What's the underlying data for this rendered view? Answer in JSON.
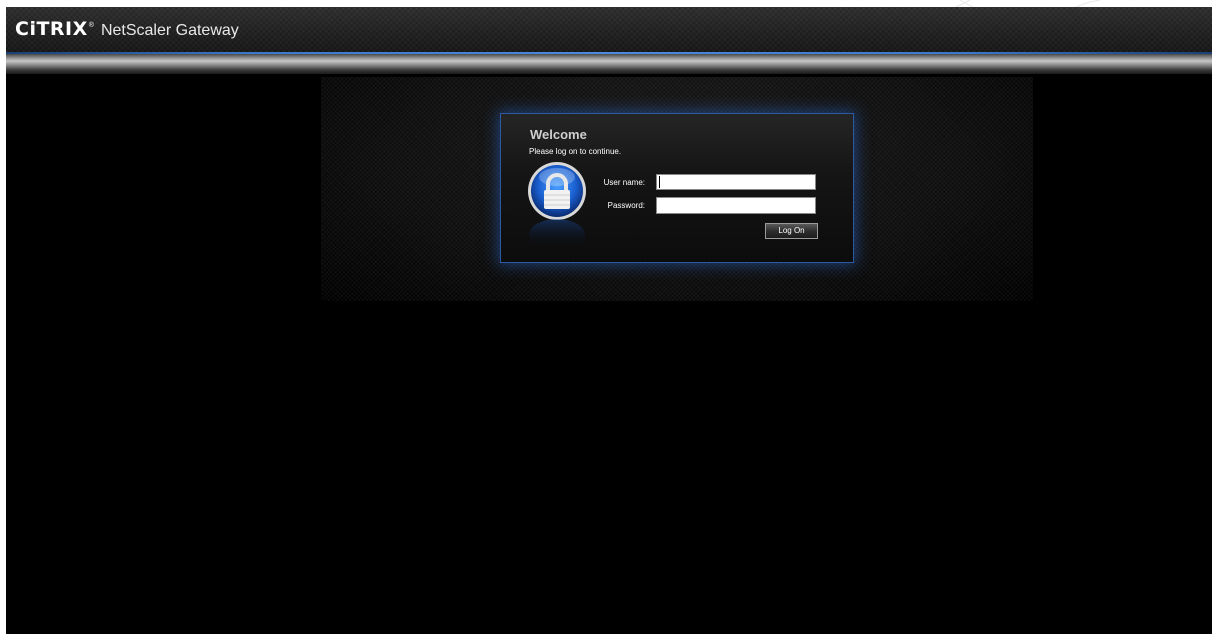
{
  "header": {
    "logo_text": "CiTRIX",
    "logo_registered": "®",
    "product_name": "NetScaler Gateway"
  },
  "login": {
    "title": "Welcome",
    "subtitle": "Please log on to continue.",
    "username_label": "User name:",
    "username_value": "",
    "password_label": "Password:",
    "password_value": "",
    "logon_label": "Log On"
  },
  "colors": {
    "background": "#000000",
    "accent_blue": "#3a78c9",
    "box_border": "#2c5aa0",
    "text": "#ffffff"
  },
  "icons": [
    "lock-icon"
  ]
}
